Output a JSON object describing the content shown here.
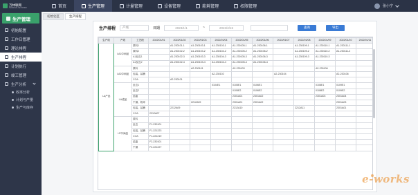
{
  "app": {
    "logo_text": "万林联网",
    "logo_sub": "TERMINAL NETWORK"
  },
  "topnav": [
    {
      "label": "首页",
      "icon": "home-icon"
    },
    {
      "label": "生产管理",
      "icon": "factory-icon"
    },
    {
      "label": "计量管理",
      "icon": "gauge-icon"
    },
    {
      "label": "设备管理",
      "icon": "device-icon"
    },
    {
      "label": "能耗管理",
      "icon": "energy-icon"
    },
    {
      "label": "权限管理",
      "icon": "lock-icon"
    }
  ],
  "user": {
    "name": "张小宁"
  },
  "sidebar": {
    "title": "生产管理",
    "items": [
      {
        "label": "初始配置",
        "icon": "settings-icon"
      },
      {
        "label": "工作日管理",
        "icon": "calendar-icon"
      },
      {
        "label": "理论排程",
        "icon": "schedule-icon"
      },
      {
        "label": "生产排程",
        "icon": "production-schedule-icon"
      },
      {
        "label": "计划执行",
        "icon": "plan-icon"
      },
      {
        "label": "竣工管理",
        "icon": "complete-icon"
      },
      {
        "label": "生产分析",
        "icon": "analysis-icon"
      }
    ],
    "sub_items": [
      "收率分析",
      "计划与产量",
      "生产与库存"
    ]
  },
  "tabs": [
    "初始化区",
    "生产排程"
  ],
  "filters": {
    "title": "生产排程",
    "select1": "产线",
    "date_label": "日期",
    "date_from": "2023/1/1",
    "sep": "~",
    "date_to": "2023/2/15",
    "btn_query": "查询",
    "btn_export": "导出"
  },
  "table": {
    "headers": [
      "生产线",
      "产线",
      "工艺段",
      "2022/01/01",
      "2022/01/02",
      "2022/01/03",
      "2022/01/04",
      "2022/01/05",
      "2022/01/06",
      "2022/01/07",
      "2022/01/08",
      "2022/01/09",
      "2022/01/10",
      "2022/01/11"
    ],
    "product_label": "I-A产品",
    "groups": [
      {
        "label": "I-A1中间品",
        "rows": [
          {
            "step": "原料1",
            "cells": [
              "",
              "A1-230101-1",
              "A1-230103-1",
              "A1-230103-1",
              "A1-230105-1",
              "A1-230106-1",
              "",
              "A1-230109-1",
              "A1-230110-1",
              "A1-230111-1",
              ""
            ]
          },
          {
            "step": "原料2",
            "cells": [
              "",
              "A1-230102-2",
              "A1-230103-2",
              "A1-230104-2",
              "A1-230105-2",
              "A1-230106-2",
              "",
              "A1-230109-2",
              "A1-230110-2",
              "A1-230111-2",
              ""
            ]
          },
          {
            "step": "A1反应1",
            "cells": [
              "",
              "A1-230102-3",
              "A1-230103-3",
              "A1-230104-3",
              "A1-230105-3",
              "A1-230106-3",
              "",
              "A1-230109-3",
              "A1-230110-3",
              "",
              ""
            ]
          },
          {
            "step": "A1反应2",
            "cells": [
              "",
              "A1-230102-4",
              "A1-230103-4",
              "A1-230104-4",
              "A1-230105-4",
              "A1-230106-4",
              "",
              "",
              "",
              "",
              ""
            ]
          }
        ]
      },
      {
        "label": "I-A2中间品",
        "rows": [
          {
            "step": "原料",
            "cells": [
              "",
              "",
              "A2-230101",
              "",
              "A2-230103",
              "",
              "",
              "",
              "A2-230106",
              "",
              ""
            ]
          },
          {
            "step": "包装、装桶",
            "cells": [
              "",
              "",
              "",
              "A2-230102",
              "",
              "",
              "A2-230104",
              "",
              "",
              "A2-230106",
              ""
            ]
          },
          {
            "step": "COA",
            "cells": [
              "",
              "A2-230101",
              "",
              "",
              "",
              "",
              "",
              "",
              "",
              "",
              ""
            ]
          }
        ]
      },
      {
        "label": "I-A成品",
        "rows": [
          {
            "step": "反应1",
            "cells": [
              "",
              "",
              "",
              "0104E1",
              "0105E1",
              "0106E1",
              "",
              "",
              "0108E1",
              "0109E1",
              ""
            ]
          },
          {
            "step": "反应2",
            "cells": [
              "",
              "",
              "",
              "",
              "0105E2",
              "0106E2",
              "",
              "",
              "0108E2",
              "0109E2",
              ""
            ]
          },
          {
            "step": "结晶",
            "cells": [
              "",
              "",
              "",
              "",
              "2301A01",
              "2301A02",
              "",
              "",
              "2301A03",
              "2301A04",
              ""
            ]
          },
          {
            "step": "干燥、粉碎",
            "cells": [
              "",
              "",
              "2212A09",
              "",
              "2301A01",
              "2301A02",
              "",
              "",
              "",
              "2301A03",
              ""
            ]
          },
          {
            "step": "包装、装桶",
            "cells": [
              "",
              "2212A09",
              "",
              "",
              "2212A10",
              "",
              "",
              "2212A11",
              "",
              "2301A01",
              ""
            ]
          },
          {
            "step": "COA",
            "cells": [
              "2212A07",
              "",
              "",
              "",
              "",
              "",
              "",
              "",
              "",
              "",
              ""
            ]
          }
        ]
      },
      {
        "label": "I-F中间品",
        "rows": [
          {
            "step": "原料",
            "cells": [
              "",
              "",
              "",
              "",
              "",
              "",
              "",
              "",
              "",
              "",
              ""
            ]
          },
          {
            "step": "反应",
            "cells": [
              "F1-230101",
              "",
              "",
              "",
              "",
              "",
              "",
              "",
              "",
              "",
              ""
            ]
          },
          {
            "step": "包装、装桶",
            "cells": [
              "F1-221223",
              "",
              "",
              "",
              "",
              "",
              "",
              "",
              "",
              "",
              ""
            ]
          },
          {
            "step": "COA",
            "cells": [
              "F1-221219",
              "",
              "",
              "",
              "",
              "",
              "",
              "",
              "",
              "",
              ""
            ]
          },
          {
            "step": "结晶",
            "cells": [
              "F2-230101",
              "",
              "",
              "",
              "",
              "",
              "",
              "",
              "",
              "",
              ""
            ]
          },
          {
            "step": "干燥",
            "cells": [
              "F2-221227",
              "",
              "",
              "",
              "",
              "",
              "",
              "",
              "",
              "",
              ""
            ]
          }
        ]
      }
    ]
  },
  "watermark": "e-works"
}
